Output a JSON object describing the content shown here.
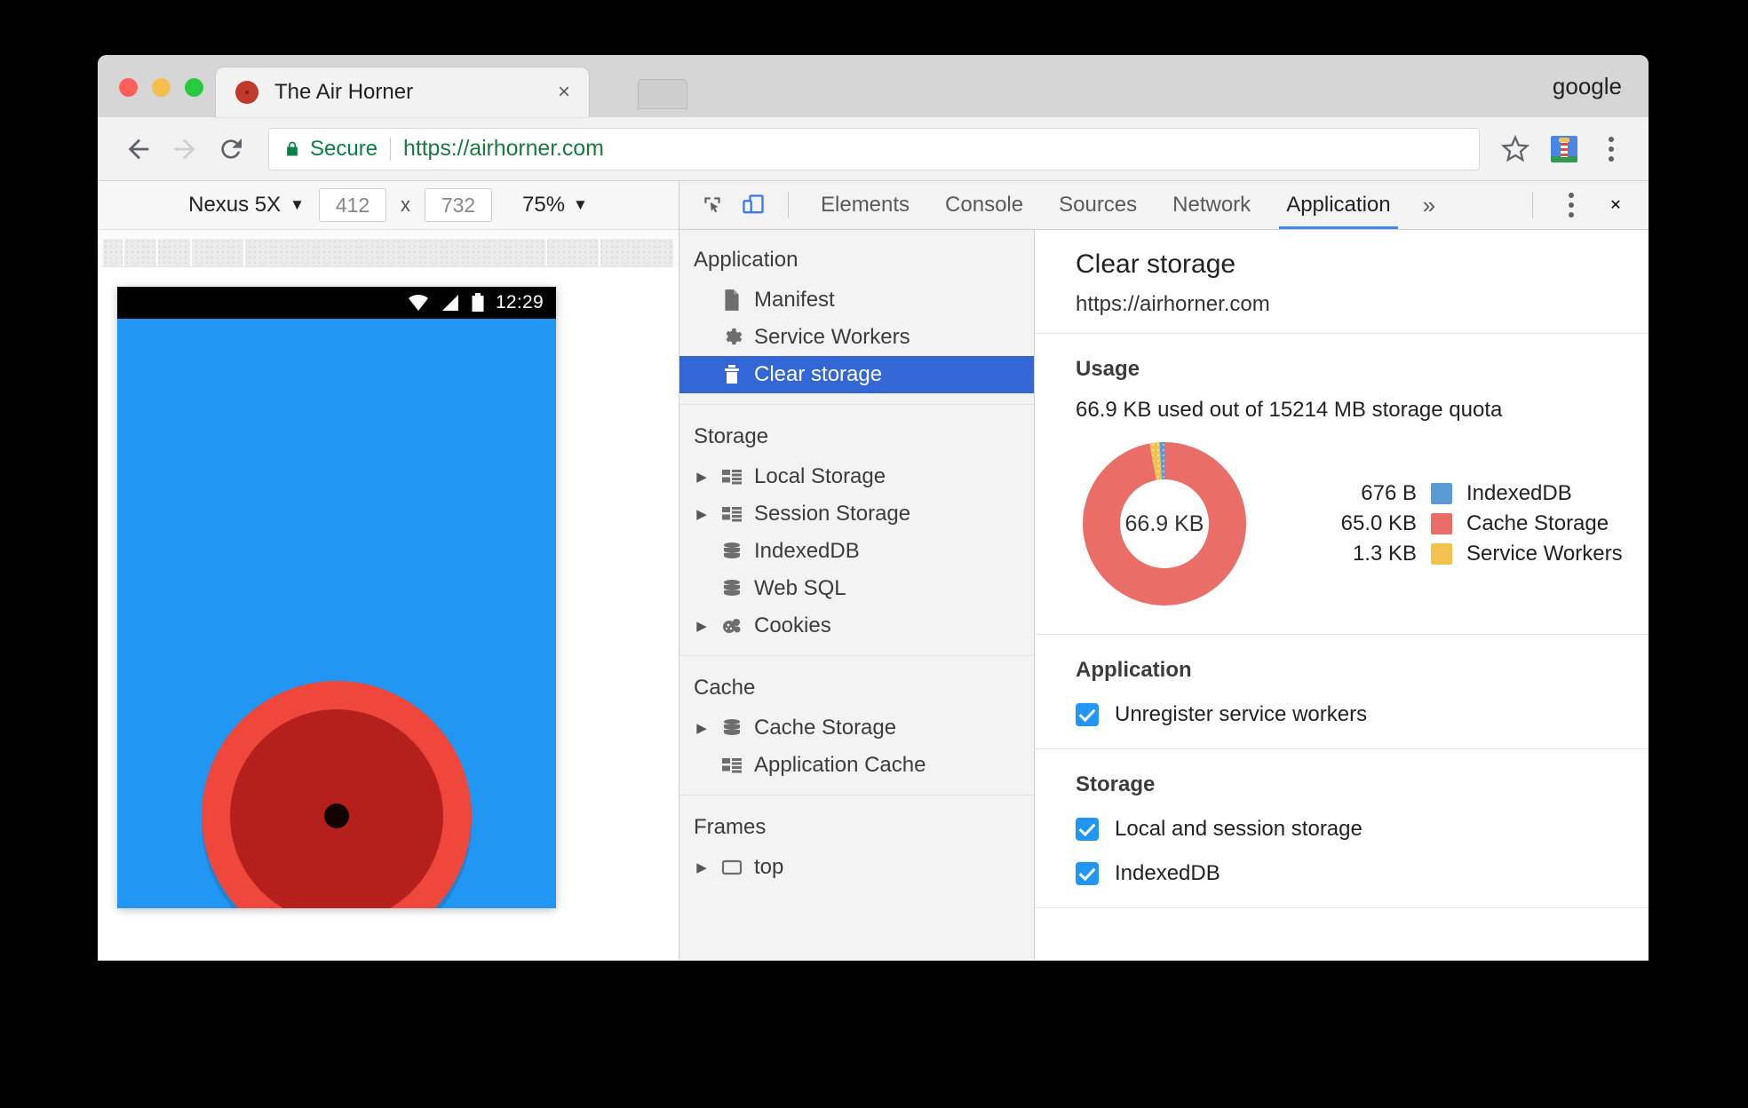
{
  "window": {
    "profile_name": "google",
    "tab": {
      "title": "The Air Horner",
      "close_label": "×",
      "favicon": "airhorn-favicon"
    },
    "new_tab_label": "+"
  },
  "toolbar": {
    "back_label": "back-arrow",
    "forward_label": "forward-arrow",
    "reload_label": "reload",
    "secure_label": "Secure",
    "url": "https://airhorner.com",
    "star_label": "bookmark-star",
    "extension_label": "lighthouse-extension",
    "menu_label": "chrome-menu"
  },
  "device_toolbar": {
    "device": "Nexus 5X",
    "width": "412",
    "height": "732",
    "x_label": "x",
    "zoom": "75%",
    "caret": "▼"
  },
  "phone": {
    "status_time": "12:29",
    "app_background": "#2196f3",
    "horn_outer_color": "#f0473c",
    "horn_inner_color": "#b5201d"
  },
  "devtools": {
    "device_mode_icons": [
      "inspect-icon",
      "device-toggle-icon"
    ],
    "tabs": [
      {
        "label": "Elements",
        "active": false
      },
      {
        "label": "Console",
        "active": false
      },
      {
        "label": "Sources",
        "active": false
      },
      {
        "label": "Network",
        "active": false
      },
      {
        "label": "Application",
        "active": true
      }
    ],
    "more_tabs_label": "»",
    "menu_label": "devtools-menu",
    "close_label": "✕",
    "accent_color": "#4285f4"
  },
  "sidebar": {
    "groups": [
      {
        "title": "Application",
        "items": [
          {
            "label": "Manifest",
            "icon": "document-icon",
            "arrow": false,
            "selected": false
          },
          {
            "label": "Service Workers",
            "icon": "gear-icon",
            "arrow": false,
            "selected": false
          },
          {
            "label": "Clear storage",
            "icon": "trash-icon",
            "arrow": false,
            "selected": true
          }
        ]
      },
      {
        "title": "Storage",
        "items": [
          {
            "label": "Local Storage",
            "icon": "table-icon",
            "arrow": true,
            "selected": false
          },
          {
            "label": "Session Storage",
            "icon": "table-icon",
            "arrow": true,
            "selected": false
          },
          {
            "label": "IndexedDB",
            "icon": "database-icon",
            "arrow": false,
            "selected": false
          },
          {
            "label": "Web SQL",
            "icon": "database-icon",
            "arrow": false,
            "selected": false
          },
          {
            "label": "Cookies",
            "icon": "cookie-icon",
            "arrow": true,
            "selected": false
          }
        ]
      },
      {
        "title": "Cache",
        "items": [
          {
            "label": "Cache Storage",
            "icon": "database-icon",
            "arrow": true,
            "selected": false
          },
          {
            "label": "Application Cache",
            "icon": "table-icon",
            "arrow": false,
            "selected": false
          }
        ]
      },
      {
        "title": "Frames",
        "items": [
          {
            "label": "top",
            "icon": "frame-icon",
            "arrow": true,
            "selected": false
          }
        ]
      }
    ]
  },
  "panel": {
    "title": "Clear storage",
    "origin": "https://airhorner.com",
    "usage": {
      "section_title": "Usage",
      "summary": "66.9 KB used out of 15214 MB storage quota",
      "donut_center": "66.9 KB"
    },
    "application": {
      "section_title": "Application",
      "checkboxes": [
        {
          "label": "Unregister service workers",
          "checked": true
        }
      ]
    },
    "storage": {
      "section_title": "Storage",
      "checkboxes": [
        {
          "label": "Local and session storage",
          "checked": true
        },
        {
          "label": "IndexedDB",
          "checked": true
        }
      ]
    }
  },
  "chart_data": {
    "type": "pie",
    "title": "Usage",
    "subtitle": "66.9 KB used out of 15214 MB storage quota",
    "center_label": "66.9 KB",
    "total_bytes": 66900,
    "unit": "bytes",
    "legend_position": "right",
    "categories": [
      "IndexedDB",
      "Cache Storage",
      "Service Workers"
    ],
    "values": [
      676,
      65000,
      1300
    ],
    "value_labels": [
      "676 B",
      "65.0 KB",
      "1.3 KB"
    ],
    "colors": [
      "#5b9bd5",
      "#eb6d68",
      "#f2c14e"
    ],
    "percents": [
      1.01,
      97.05,
      1.94
    ],
    "donut": true,
    "inner_radius_ratio": 0.58
  }
}
